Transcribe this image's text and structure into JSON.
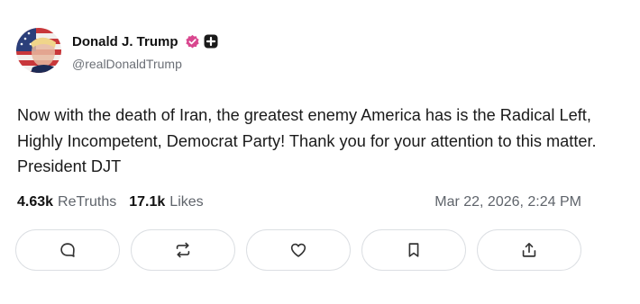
{
  "post": {
    "author": {
      "display_name": "Donald J. Trump",
      "handle": "@realDonaldTrump",
      "verified_badge_color": "#d9478f",
      "avatar_icon": "avatar-image"
    },
    "text": "Now with the death of Iran, the greatest enemy America has is the Radical Left, Highly Incompetent, Democrat Party! Thank you for your attention to this matter. President DJT",
    "stats": {
      "retruths_count": "4.63k",
      "retruths_label": "ReTruths",
      "likes_count": "17.1k",
      "likes_label": "Likes"
    },
    "timestamp": "Mar 22, 2026, 2:24 PM",
    "actions": [
      {
        "icon": "reply-icon"
      },
      {
        "icon": "retruth-icon"
      },
      {
        "icon": "like-icon"
      },
      {
        "icon": "bookmark-icon"
      },
      {
        "icon": "share-icon"
      }
    ]
  }
}
